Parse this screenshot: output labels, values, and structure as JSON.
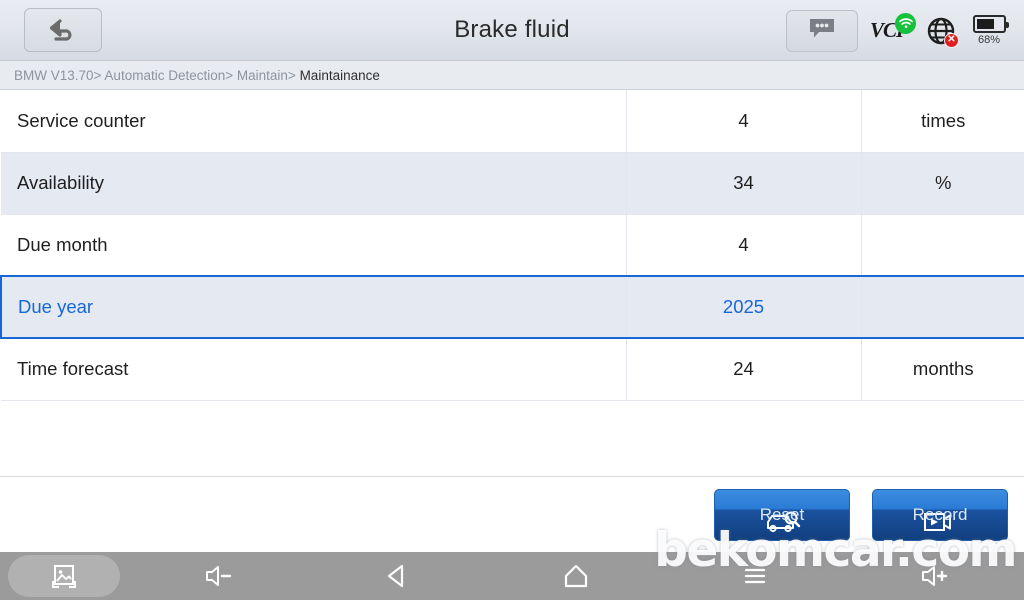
{
  "header": {
    "title": "Brake fluid",
    "back_icon": "back-arrow-icon",
    "chat_icon": "chat-bubble-icon",
    "vci_label": "VCI",
    "vci_wifi_icon": "wifi-connected-icon",
    "globe_icon": "globe-icon",
    "globe_status_icon": "no-internet-x-icon",
    "battery_icon": "battery-icon",
    "battery_percent": "68%",
    "battery_level": 68
  },
  "breadcrumb": {
    "segments": [
      {
        "label": "BMW V13.70",
        "sep": ">",
        "current": false
      },
      {
        "label": " Automatic Detection",
        "sep": ">",
        "current": false
      },
      {
        "label": " Maintain",
        "sep": ">",
        "current": false
      },
      {
        "label": " Maintainance",
        "sep": "",
        "current": true
      }
    ]
  },
  "table": {
    "rows": [
      {
        "label": "Service counter",
        "value": "4",
        "unit": "times",
        "alt": false,
        "selected": false
      },
      {
        "label": "Availability",
        "value": "34",
        "unit": "%",
        "alt": true,
        "selected": false
      },
      {
        "label": "Due month",
        "value": "4",
        "unit": "",
        "alt": false,
        "selected": false
      },
      {
        "label": "Due year",
        "value": "2025",
        "unit": "",
        "alt": true,
        "selected": true
      },
      {
        "label": "Time forecast",
        "value": "24",
        "unit": "months",
        "alt": false,
        "selected": false
      }
    ]
  },
  "footer": {
    "buttons": [
      {
        "label": "Reset",
        "icon": "car-diagnostic-icon"
      },
      {
        "label": "Record",
        "icon": "video-record-icon"
      }
    ]
  },
  "navbar": {
    "items": [
      {
        "icon": "screenshot-icon",
        "active": true
      },
      {
        "icon": "volume-down-icon",
        "active": false
      },
      {
        "icon": "back-triangle-icon",
        "active": false
      },
      {
        "icon": "home-icon",
        "active": false
      },
      {
        "icon": "menu-icon",
        "active": false
      },
      {
        "icon": "volume-up-icon",
        "active": false
      }
    ]
  },
  "watermark": {
    "text": "bekomcar.com"
  },
  "colors": {
    "accent": "#1767d6",
    "header_bg": "#e3e7ed",
    "row_alt": "#e5e9f1",
    "navbar_bg": "#9b9b9b",
    "button_blue": "#2a7ad4",
    "wifi_green": "#16c13c",
    "error_red": "#e02020"
  }
}
